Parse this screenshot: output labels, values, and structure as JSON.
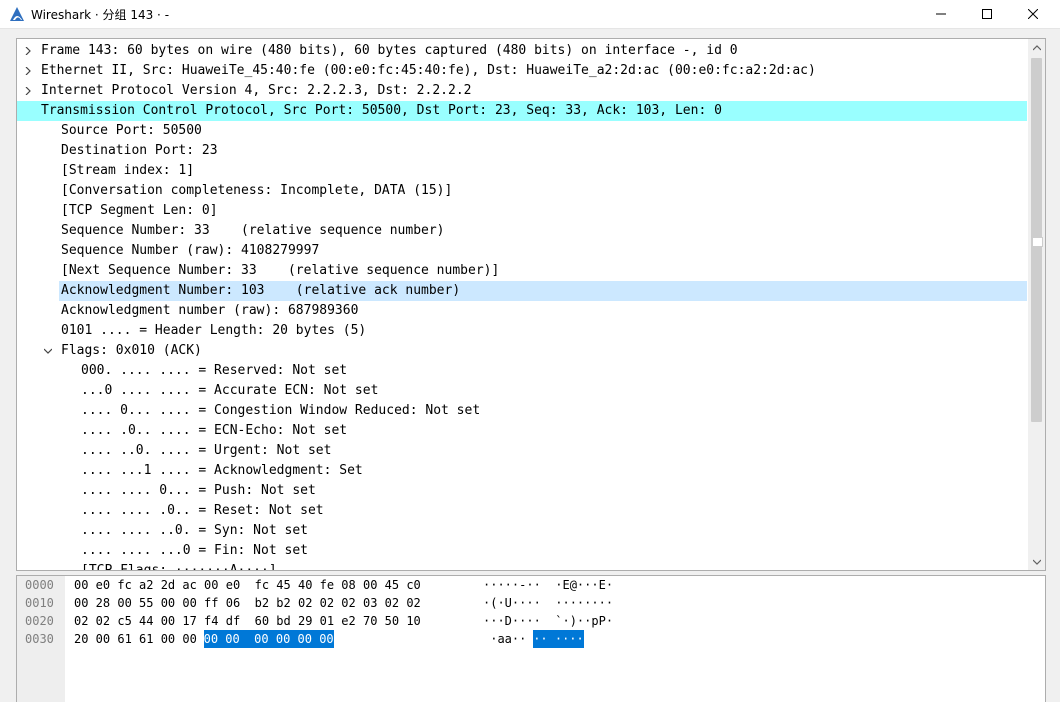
{
  "window": {
    "title": "Wireshark · 分组 143 · -",
    "icon": "wireshark-fin-icon",
    "controls": [
      "minimize-icon",
      "maximize-icon",
      "close-icon"
    ]
  },
  "colors": {
    "selected_protocol": "#99ffff",
    "selected_field": "#cce8ff",
    "hex_highlight": "#0078d7",
    "app_icon": "#2f6fbf"
  },
  "tree": {
    "rows": [
      {
        "text": "Frame 143: 60 bytes on wire (480 bits), 60 bytes captured (480 bits) on interface -, id 0",
        "level": 0,
        "expander": "collapsed"
      },
      {
        "text": "Ethernet II, Src: HuaweiTe_45:40:fe (00:e0:fc:45:40:fe), Dst: HuaweiTe_a2:2d:ac (00:e0:fc:a2:2d:ac)",
        "level": 0,
        "expander": "collapsed"
      },
      {
        "text": "Internet Protocol Version 4, Src: 2.2.2.3, Dst: 2.2.2.2",
        "level": 0,
        "expander": "collapsed"
      },
      {
        "text": "Transmission Control Protocol, Src Port: 50500, Dst Port: 23, Seq: 33, Ack: 103, Len: 0",
        "level": 0,
        "expander": "expanded",
        "highlight": "protocol"
      },
      {
        "text": "Source Port: 50500",
        "level": 1
      },
      {
        "text": "Destination Port: 23",
        "level": 1
      },
      {
        "text": "[Stream index: 1]",
        "level": 1
      },
      {
        "text": "[Conversation completeness: Incomplete, DATA (15)]",
        "level": 1
      },
      {
        "text": "[TCP Segment Len: 0]",
        "level": 1
      },
      {
        "text": "Sequence Number: 33    (relative sequence number)",
        "level": 1
      },
      {
        "text": "Sequence Number (raw): 4108279997",
        "level": 1
      },
      {
        "text": "[Next Sequence Number: 33    (relative sequence number)]",
        "level": 1
      },
      {
        "text": "Acknowledgment Number: 103    (relative ack number)",
        "level": 1,
        "highlight": "field"
      },
      {
        "text": "Acknowledgment number (raw): 687989360",
        "level": 1
      },
      {
        "text": "0101 .... = Header Length: 20 bytes (5)",
        "level": 1
      },
      {
        "text": "Flags: 0x010 (ACK)",
        "level": 1,
        "expander": "expanded"
      },
      {
        "text": "000. .... .... = Reserved: Not set",
        "level": 2
      },
      {
        "text": "...0 .... .... = Accurate ECN: Not set",
        "level": 2
      },
      {
        "text": ".... 0... .... = Congestion Window Reduced: Not set",
        "level": 2
      },
      {
        "text": ".... .0.. .... = ECN-Echo: Not set",
        "level": 2
      },
      {
        "text": ".... ..0. .... = Urgent: Not set",
        "level": 2
      },
      {
        "text": ".... ...1 .... = Acknowledgment: Set",
        "level": 2
      },
      {
        "text": ".... .... 0... = Push: Not set",
        "level": 2
      },
      {
        "text": ".... .... .0.. = Reset: Not set",
        "level": 2
      },
      {
        "text": ".... .... ..0. = Syn: Not set",
        "level": 2
      },
      {
        "text": ".... .... ...0 = Fin: Not set",
        "level": 2
      },
      {
        "text": "[TCP Flags: ·······A····]",
        "level": 2
      }
    ]
  },
  "hex": {
    "rows": [
      {
        "offset": "0000",
        "hex": "00 e0 fc a2 2d ac 00 e0  fc 45 40 fe 08 00 45 c0",
        "hex_hl": "",
        "ascii": "·····-··  ·E@···E·",
        "ascii_hl": ""
      },
      {
        "offset": "0010",
        "hex": "00 28 00 55 00 00 ff 06  b2 b2 02 02 02 03 02 02",
        "hex_hl": "",
        "ascii": "·(·U····  ········",
        "ascii_hl": ""
      },
      {
        "offset": "0020",
        "hex": "02 02 c5 44 00 17 f4 df  60 bd 29 01 e2 70 50 10",
        "hex_hl": "",
        "ascii": "···D····  `·)··pP·",
        "ascii_hl": ""
      },
      {
        "offset": "0030",
        "hex": "20 00 61 61 00 00 ",
        "hex_hl": "00 00  00 00 00 00",
        "ascii": " ·aa··",
        "ascii_hl": "·· ····"
      }
    ]
  }
}
